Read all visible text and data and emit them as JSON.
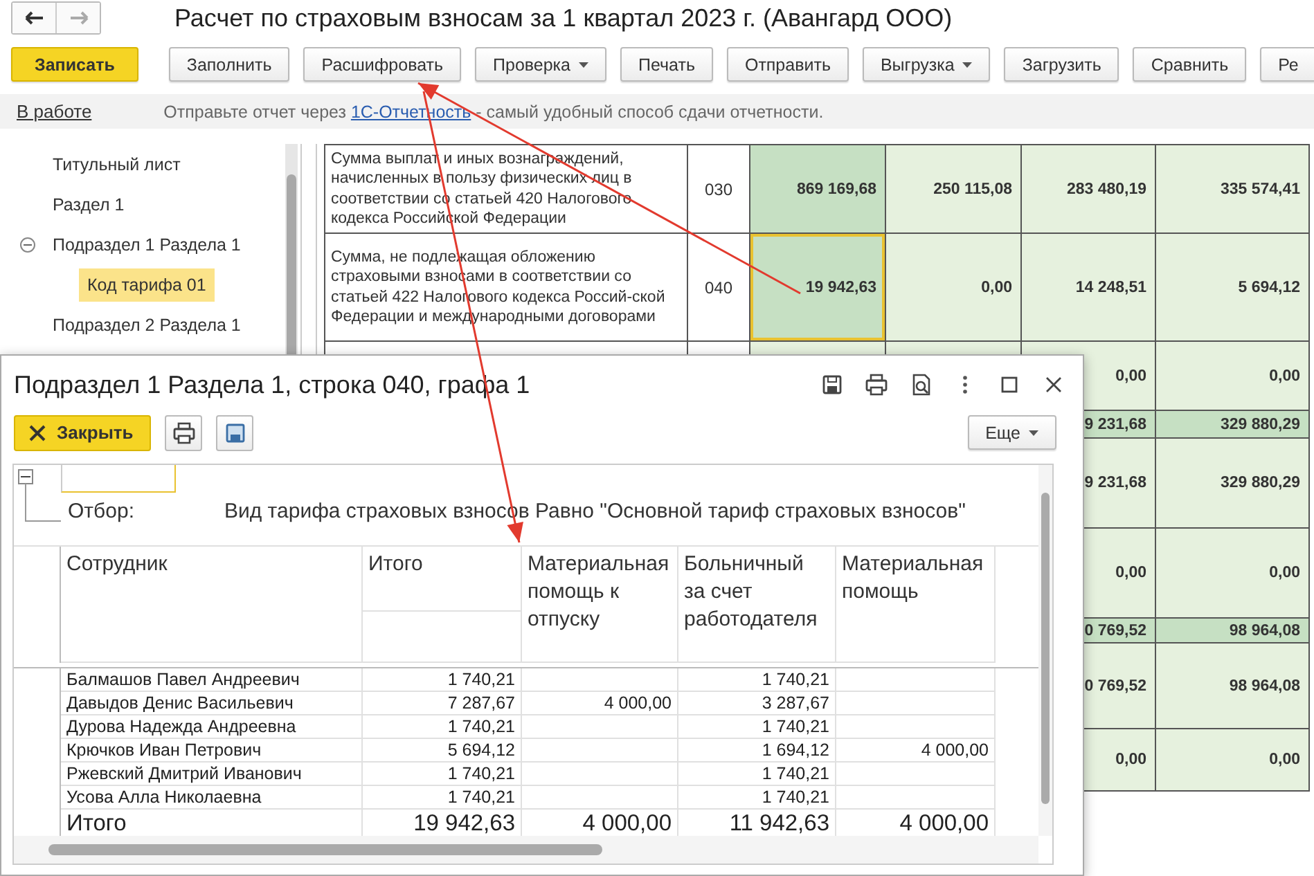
{
  "window": {
    "title": "Расчет по страховым взносам за 1 квартал 2023 г. (Авангард ООО)"
  },
  "toolbar": [
    {
      "label": "Записать",
      "kind": "primary"
    },
    {
      "label": "Заполнить",
      "kind": "plain"
    },
    {
      "label": "Расшифровать",
      "kind": "plain"
    },
    {
      "label": "Проверка",
      "kind": "dropdown"
    },
    {
      "label": "Печать",
      "kind": "plain"
    },
    {
      "label": "Отправить",
      "kind": "plain"
    },
    {
      "label": "Выгрузка",
      "kind": "dropdown"
    },
    {
      "label": "Загрузить",
      "kind": "plain"
    },
    {
      "label": "Сравнить",
      "kind": "plain"
    },
    {
      "label": "Ре",
      "kind": "plain"
    }
  ],
  "status_bar": {
    "state": "В работе",
    "message_before": "Отправьте отчет через ",
    "link": "1С-Отчетность",
    "message_after": " - самый удобный способ сдачи отчетности."
  },
  "sidebar": {
    "items": [
      {
        "label": "Титульный лист",
        "selected": false
      },
      {
        "label": "Раздел 1",
        "selected": false
      },
      {
        "label": "Подраздел 1 Раздела 1",
        "selected": false,
        "expanded": true,
        "children": [
          {
            "label": "Код тарифа 01",
            "selected": true
          }
        ]
      },
      {
        "label": "Подраздел 2 Раздела 1",
        "selected": false
      }
    ]
  },
  "report_rows": [
    {
      "description": "Сумма выплат и иных вознаграждений, начисленных в пользу физических лиц в соответствии со статьей 420 Налогового кодекса Российской Федерации",
      "code": "030",
      "cells": [
        {
          "text": "869 169,68",
          "selected": false
        },
        {
          "text": "250 115,08",
          "selected": false
        },
        {
          "text": "283 480,19",
          "selected": false
        },
        {
          "text": "335 574,41",
          "selected": false
        }
      ]
    },
    {
      "description": "Сумма, не подлежащая обложению страховыми взносами в соответствии со статьей 422 Налогового кодекса Россий-ской Федерации и международными договорами",
      "code": "040",
      "cells": [
        {
          "text": "19 942,63",
          "selected": true
        },
        {
          "text": "0,00",
          "selected": false
        },
        {
          "text": "14 248,51",
          "selected": false
        },
        {
          "text": "5 694,12",
          "selected": false
        }
      ]
    }
  ],
  "rows_behind_dialog": [
    {
      "kind": "data",
      "column_3": "0,00",
      "column_4": "0,00"
    },
    {
      "kind": "total",
      "column_3": "9 231,68",
      "column_4": "329 880,29"
    },
    {
      "kind": "data",
      "column_3": "9 231,68",
      "column_4": "329 880,29"
    },
    {
      "kind": "data",
      "column_3": "0,00",
      "column_4": "0,00"
    },
    {
      "kind": "total",
      "column_3": "0 769,52",
      "column_4": "98 964,08"
    },
    {
      "kind": "data",
      "column_3": "0 769,52",
      "column_4": "98 964,08"
    },
    {
      "kind": "data",
      "column_3": "0,00",
      "column_4": "0,00"
    }
  ],
  "dialog": {
    "title": "Подраздел 1 Раздела 1, строка 040, графа 1",
    "close_button": "Закрыть",
    "more_button": "Еще",
    "filter_label": "Отбор:",
    "filter_text": "Вид тарифа страховых взносов Равно \"Основной тариф страховых взносов\"",
    "columns": [
      "Сотрудник",
      "Итого",
      "Материальная помощь к отпуску",
      "Больничный за счет работодателя",
      "Материальная помощь"
    ],
    "rows": [
      {
        "employee": "Балмашов Павел Андреевич",
        "total": "1 740,21",
        "sick_leave": "1 740,21"
      },
      {
        "employee": "Давыдов Денис Васильевич",
        "total": "7 287,67",
        "vacation_aid": "4 000,00",
        "sick_leave": "3 287,67"
      },
      {
        "employee": "Дурова Надежда Андреевна",
        "total": "1 740,21",
        "sick_leave": "1 740,21"
      },
      {
        "employee": "Крючков Иван Петрович",
        "total": "5 694,12",
        "sick_leave": "1 694,12",
        "material_aid": "4 000,00"
      },
      {
        "employee": "Ржевский Дмитрий Иванович",
        "total": "1 740,21",
        "sick_leave": "1 740,21"
      },
      {
        "employee": "Усова Алла Николаевна",
        "total": "1 740,21",
        "sick_leave": "1 740,21"
      }
    ],
    "totals": {
      "employee": "Итого",
      "total": "19 942,63",
      "vacation_aid": "4 000,00",
      "sick_leave": "11 942,63",
      "material_aid": "4 000,00"
    }
  }
}
